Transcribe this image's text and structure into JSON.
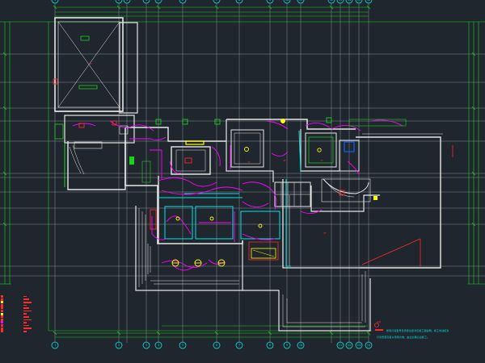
{
  "drawing": {
    "type": "electrical lighting floor plan",
    "colors": {
      "background": "#20262e",
      "wall": "#e6e6e6",
      "grid": "#8a8f96",
      "dimension": "#19d21a",
      "wiring": "#ff00ff",
      "fixture": "#ffff00",
      "cyan": "#00e5e5",
      "red": "#ff2a2a"
    },
    "grid_bubbles_top": [
      "1",
      "2",
      "3",
      "4",
      "5",
      "6",
      "7",
      "8",
      "9",
      "10",
      "11",
      "12",
      "13",
      "14",
      "15",
      "16"
    ],
    "grid_bubbles_bottom": [
      "1",
      "2",
      "3",
      "4",
      "5",
      "6",
      "7",
      "8",
      "9",
      "10",
      "11",
      "12",
      "13",
      "14"
    ],
    "legend": {
      "rows": 13
    },
    "notes_title": "说明",
    "notes": [
      "所有灯具型号及安装位置详见施工图说明，施工时请核对",
      "灯具安装高度以现场为准，由业主确认后施工。"
    ]
  }
}
